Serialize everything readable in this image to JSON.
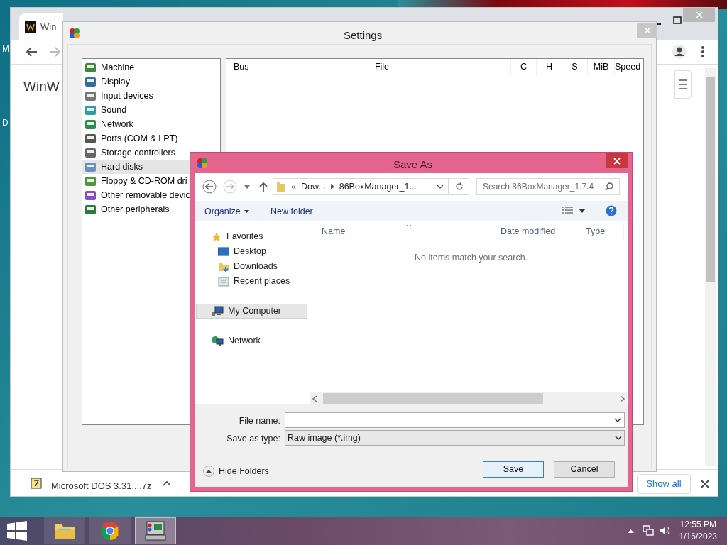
{
  "desktop": {
    "edge_labels": [
      "M",
      "D"
    ]
  },
  "browser": {
    "tab_title": "Win",
    "page_heading": "WinW",
    "download": {
      "file": "Microsoft DOS 3.31....7z",
      "show_all": "Show all"
    }
  },
  "settings": {
    "title": "Settings",
    "categories": [
      {
        "label": "Machine",
        "selected": false
      },
      {
        "label": "Display",
        "selected": false
      },
      {
        "label": "Input devices",
        "selected": false
      },
      {
        "label": "Sound",
        "selected": false
      },
      {
        "label": "Network",
        "selected": false
      },
      {
        "label": "Ports (COM & LPT)",
        "selected": false
      },
      {
        "label": "Storage controllers",
        "selected": false
      },
      {
        "label": "Hard disks",
        "selected": true
      },
      {
        "label": "Floppy & CD-ROM dri",
        "selected": false
      },
      {
        "label": "Other removable devic",
        "selected": false
      },
      {
        "label": "Other peripherals",
        "selected": false
      }
    ],
    "columns": [
      "Bus",
      "File",
      "C",
      "H",
      "S",
      "MiB",
      "Speed"
    ]
  },
  "save_as": {
    "title": "Save As",
    "address": {
      "overflow": "«",
      "parent": "Dow...",
      "current": "86BoxManager_1..."
    },
    "search": {
      "placeholder": "Search 86BoxManager_1.7.4"
    },
    "toolbar": {
      "organize": "Organize",
      "new_folder": "New folder"
    },
    "nav": [
      {
        "label": "Favorites",
        "kind": "star",
        "selected": false,
        "children": [
          {
            "label": "Desktop",
            "kind": "desktop",
            "selected": false
          },
          {
            "label": "Downloads",
            "kind": "downloads",
            "selected": false
          },
          {
            "label": "Recent places",
            "kind": "recent",
            "selected": false
          }
        ]
      },
      {
        "label": "My Computer",
        "kind": "computer",
        "selected": true
      },
      {
        "label": "Network",
        "kind": "network",
        "selected": false
      }
    ],
    "columns": [
      "Name",
      "Date modified",
      "Type"
    ],
    "empty_message": "No items match your search.",
    "file_name": {
      "label": "File name:"
    },
    "save_type": {
      "label": "Save as type:",
      "value": "Raw image (*.img)"
    },
    "hide_folders": "Hide Folders",
    "buttons": [
      {
        "label": "Save",
        "default": true
      },
      {
        "label": "Cancel",
        "default": false
      }
    ]
  },
  "taskbar": {
    "apps": [
      {
        "kind": "explorer",
        "active": false
      },
      {
        "kind": "chrome",
        "active": false
      },
      {
        "kind": "emulator",
        "active": true
      }
    ],
    "time": "12:55 PM",
    "date": "1/16/2023"
  }
}
